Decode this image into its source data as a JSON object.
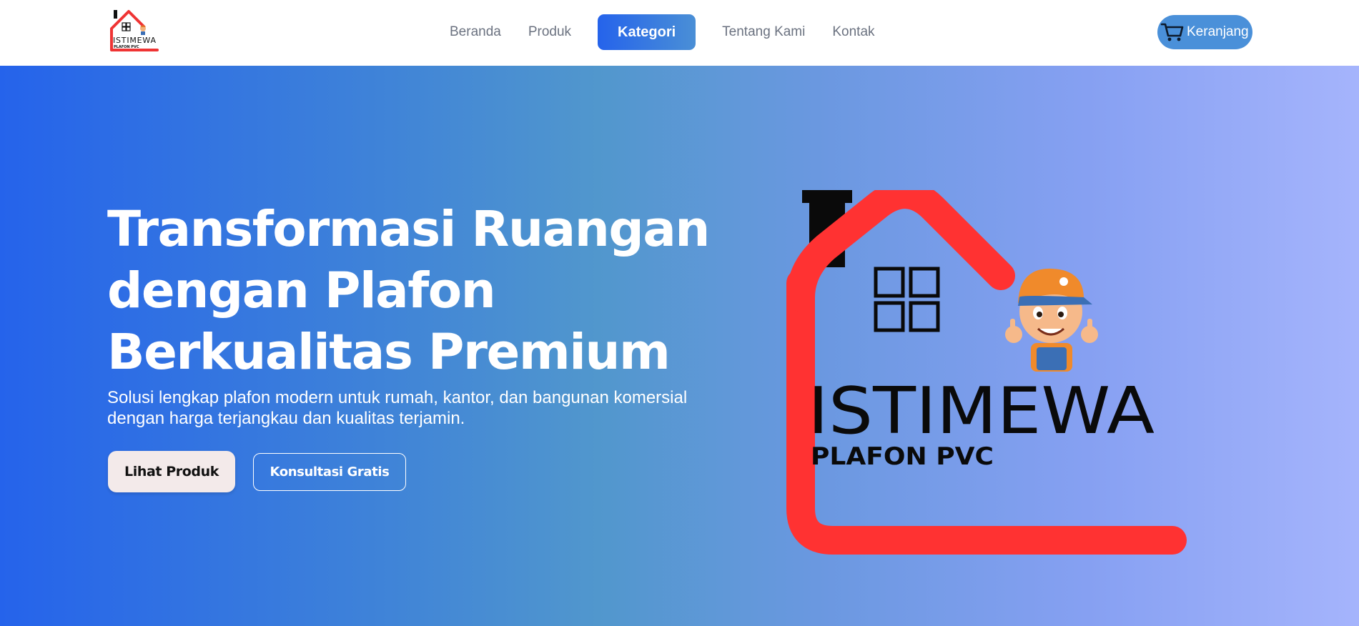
{
  "header": {
    "logo": {
      "brand": "ISTIMEWA",
      "tagline": "PLAFON PVC",
      "icon": "house-logo-icon"
    },
    "nav": [
      {
        "label": "Beranda",
        "active": false
      },
      {
        "label": "Produk",
        "active": false
      },
      {
        "label": "Kategori",
        "active": true
      },
      {
        "label": "Tentang Kami",
        "active": false
      },
      {
        "label": "Kontak",
        "active": false
      }
    ],
    "cart": {
      "label": "Keranjang",
      "icon": "cart-icon"
    }
  },
  "hero": {
    "title": "Transformasi Ruangan dengan Plafon Berkualitas Premium",
    "subtitle": "Solusi lengkap plafon modern untuk rumah, kantor, dan bangunan komersial dengan harga terjangkau dan kualitas terjamin.",
    "primary_button": "Lihat Produk",
    "secondary_button": "Konsultasi Gratis",
    "illustration": {
      "brand": "ISTIMEWA",
      "tagline": "PLAFON PVC"
    }
  },
  "colors": {
    "accent": "#2563eb",
    "house_roof": "#ff3232",
    "cart_bg": "#4a90d9",
    "gradient_start": "#2563eb",
    "gradient_end": "#a5b4fc"
  }
}
